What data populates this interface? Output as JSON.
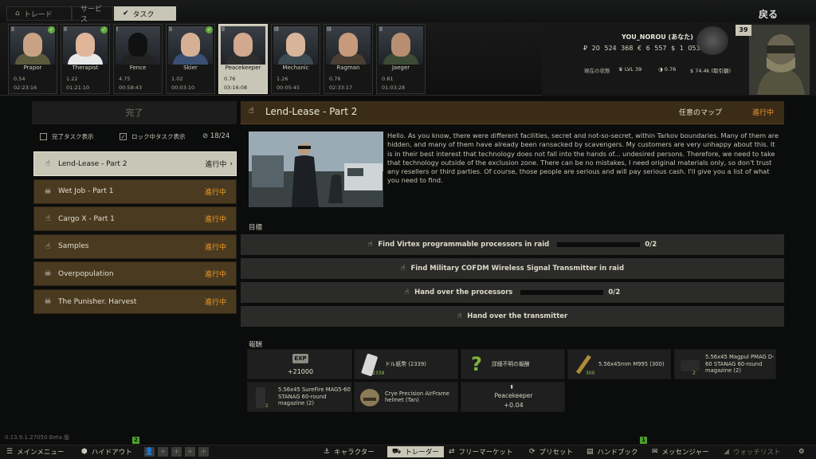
{
  "top_tabs": [
    {
      "label": "トレード",
      "icon": "shopping-basket-icon"
    },
    {
      "label": "サービス",
      "icon": ""
    },
    {
      "label": "タスク",
      "icon": "check-circle-icon"
    }
  ],
  "back_label": "戻る",
  "traders": [
    {
      "name": "Prapor",
      "standing": "0.54",
      "timer": "02:23:16",
      "level": "ll",
      "checked": true
    },
    {
      "name": "Therapist",
      "standing": "1.22",
      "timer": "01:21:10",
      "level": "ll",
      "checked": true
    },
    {
      "name": "Fence",
      "standing": "4.75",
      "timer": "00:58:43",
      "level": "l",
      "checked": false
    },
    {
      "name": "Skier",
      "standing": "1.02",
      "timer": "00:03:10",
      "level": "ll",
      "checked": true
    },
    {
      "name": "Peacekeeper",
      "standing": "0.76",
      "timer": "03:16:08",
      "level": "ll",
      "checked": false
    },
    {
      "name": "Mechanic",
      "standing": "1.26",
      "timer": "00:05:45",
      "level": "lll",
      "checked": false
    },
    {
      "name": "Ragman",
      "standing": "0.76",
      "timer": "02:33:17",
      "level": "lll",
      "checked": false
    },
    {
      "name": "Jaeger",
      "standing": "0.81",
      "timer": "01:03:28",
      "level": "ll",
      "checked": false
    }
  ],
  "player": {
    "name": "YOU_NOROU (あなた)",
    "roubles": "₽ 20 524 368",
    "euros": "€ 6 557",
    "dollars": "$ 1 053",
    "state_label": "現在の状態",
    "level": "LVL 39",
    "standing": "0.76",
    "sales": "$ 74.4k (取引額)",
    "level_badge": "39"
  },
  "left": {
    "completed_header": "完了",
    "show_completed": "完了タスク表示",
    "show_locked": "ロック中タスク表示",
    "task_count": "18/24",
    "quests": [
      {
        "title": "Lend-Lease - Part 2",
        "status": "進行中",
        "icon": "hand-pointer-icon"
      },
      {
        "title": "Wet Job - Part 1",
        "status": "進行中",
        "icon": "skull-icon"
      },
      {
        "title": "Cargo X - Part 1",
        "status": "進行中",
        "icon": "hand-pointer-icon"
      },
      {
        "title": "Samples",
        "status": "進行中",
        "icon": "hand-pointer-icon"
      },
      {
        "title": "Overpopulation",
        "status": "進行中",
        "icon": "skull-icon"
      },
      {
        "title": "The Punisher. Harvest",
        "status": "進行中",
        "icon": "skull-icon"
      }
    ]
  },
  "quest": {
    "title": "Lend-Lease - Part 2",
    "map": "任意のマップ",
    "status": "進行中",
    "description": "Hello. As you know, there were different facilities, secret and not-so-secret, within Tarkov boundaries. Many of them are hidden, and many of them have already been ransacked by scavengers. My customers are very unhappy about this. It is in their best interest that technology does not fall into the hands of... undesired persons. Therefore, we need to take that technology outside of the exclusion zone. There can be no mistakes, I need original materials only, so don't trust any resellers or third parties. Of course, those people are serious and will pay serious cash. I'll give you a list of what you need to find.",
    "objectives_label": "目標",
    "objectives": [
      {
        "text": "Find Virtex programmable processors in raid",
        "progress": "0/2",
        "has_bar": true
      },
      {
        "text": "Find Military COFDM Wireless Signal Transmitter in raid",
        "progress": "",
        "has_bar": false
      },
      {
        "text": "Hand over the processors",
        "progress": "0/2",
        "has_bar": true
      },
      {
        "text": "Hand over the transmitter",
        "progress": "",
        "has_bar": false
      }
    ],
    "rewards_label": "報酬",
    "rewards": [
      {
        "kind": "exp",
        "badge": "EXP",
        "value": "+21000"
      },
      {
        "kind": "item",
        "text": "ドル紙幣 (2339)",
        "count": "2339"
      },
      {
        "kind": "item",
        "text": "詳細不明の報酬",
        "count": ""
      },
      {
        "kind": "item",
        "text": "5.56x45mm M995 (300)",
        "count": "300"
      },
      {
        "kind": "item",
        "text": "5.56x45 Magpul PMAG D-60 STANAG 60-round magazine (2)",
        "count": "2"
      },
      {
        "kind": "item",
        "text": "5.56x45 SureFire MAG5-60 STANAG 60-round magazine (2)",
        "count": "2"
      },
      {
        "kind": "item",
        "text": "Crye Precision AirFrame helmet (Tan)",
        "count": ""
      },
      {
        "kind": "standing",
        "name": "Peacekeeper",
        "value": "+0.04"
      }
    ]
  },
  "version": "0.13.9.1.27050 Beta 版",
  "bottom": {
    "main_menu": "メインメニュー",
    "hideout": "ハイドアウト",
    "hideout_badge": "2",
    "character": "キャラクター",
    "traders": "トレーダー",
    "flea_market": "フリーマーケット",
    "handbook": "プリセット",
    "builds": "ハンドブック",
    "messenger": "メッセンジャー",
    "messenger_badge": "1",
    "watchlist": "ウォッチリスト"
  },
  "colors": {
    "accent": "#f39c24",
    "selected": "#c8c6b6",
    "quest_bg": "#4a3a20",
    "green": "#4fa02e"
  }
}
